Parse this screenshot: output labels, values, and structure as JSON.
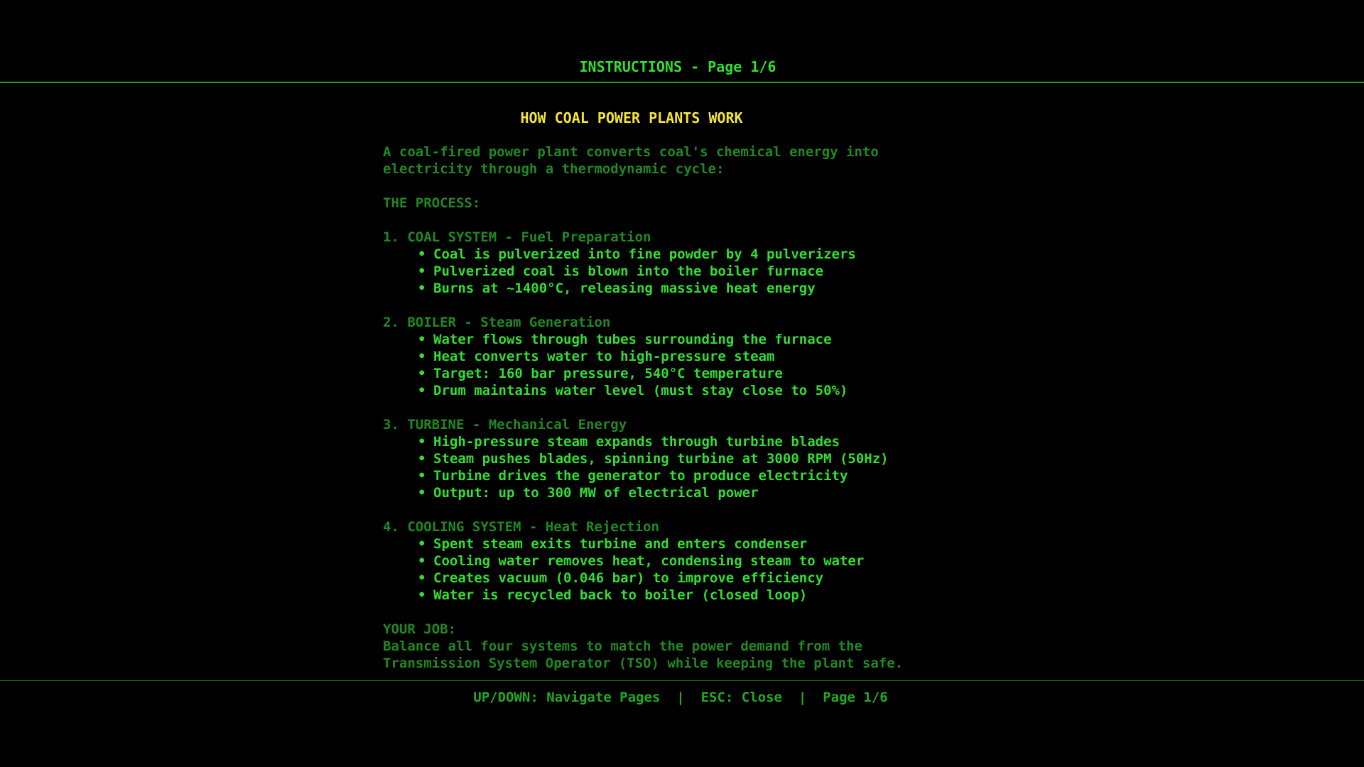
{
  "header": {
    "title": "INSTRUCTIONS - Page 1/6"
  },
  "page": {
    "heading": "HOW COAL POWER PLANTS WORK",
    "intro": [
      "A coal-fired power plant converts coal's chemical energy into",
      "electricity through a thermodynamic cycle:"
    ],
    "process_label": "THE PROCESS:",
    "sections": [
      {
        "title": "1. COAL SYSTEM - Fuel Preparation",
        "bullets": [
          "Coal is pulverized into fine powder by 4 pulverizers",
          "Pulverized coal is blown into the boiler furnace",
          "Burns at ~1400°C, releasing massive heat energy"
        ]
      },
      {
        "title": "2. BOILER - Steam Generation",
        "bullets": [
          "Water flows through tubes surrounding the furnace",
          "Heat converts water to high-pressure steam",
          "Target: 160 bar pressure, 540°C temperature",
          "Drum maintains water level (must stay close to 50%)"
        ]
      },
      {
        "title": "3. TURBINE - Mechanical Energy",
        "bullets": [
          "High-pressure steam expands through turbine blades",
          "Steam pushes blades, spinning turbine at 3000 RPM (50Hz)",
          "Turbine drives the generator to produce electricity",
          "Output: up to 300 MW of electrical power"
        ]
      },
      {
        "title": "4. COOLING SYSTEM - Heat Rejection",
        "bullets": [
          "Spent steam exits turbine and enters condenser",
          "Cooling water removes heat, condensing steam to water",
          "Creates vacuum (0.046 bar) to improve efficiency",
          "Water is recycled back to boiler (closed loop)"
        ]
      }
    ],
    "job_label": "YOUR JOB:",
    "job_text": [
      "Balance all four systems to match the power demand from the",
      "Transmission System Operator (TSO) while keeping the plant safe."
    ]
  },
  "footer": {
    "navigate": "UP/DOWN: Navigate Pages",
    "separator": "|",
    "close": "ESC: Close",
    "page": "Page 1/6"
  },
  "bullet_glyph": "•",
  "colors": {
    "background": "#000000",
    "header_text": "#33dd33",
    "heading_yellow": "#f2e53a",
    "dim_green": "#228822",
    "bright_green": "#33dd33",
    "rule": "#1f9e1f"
  }
}
